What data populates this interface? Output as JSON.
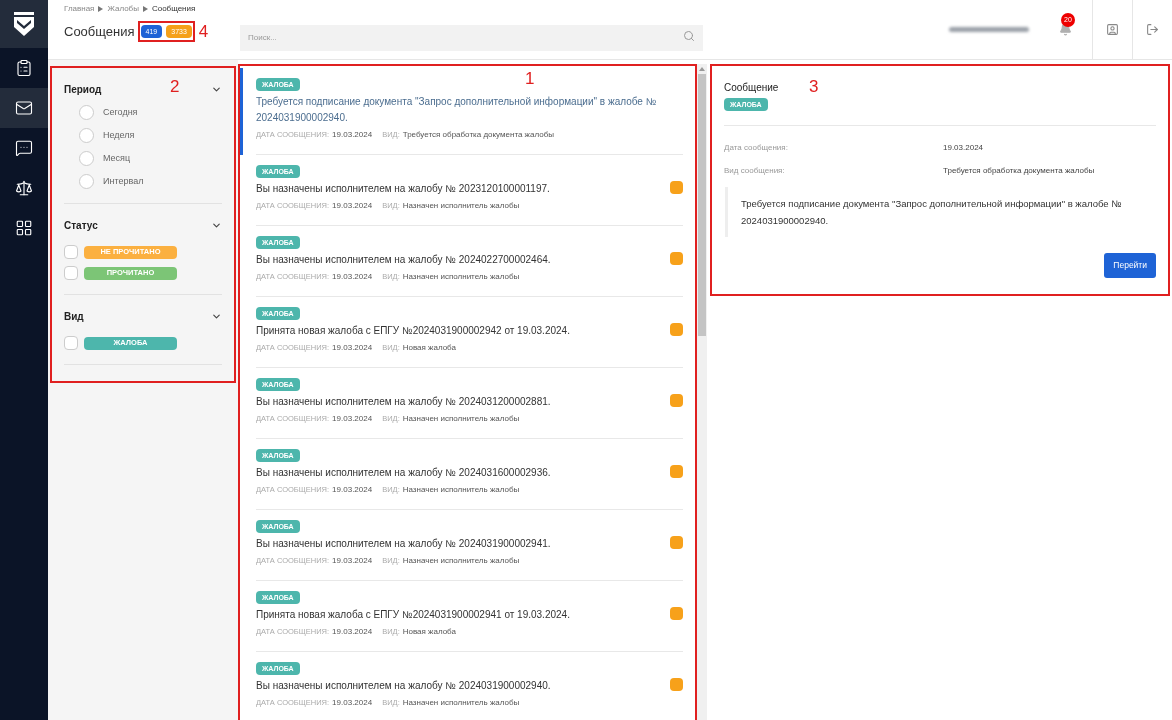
{
  "sidebar": {
    "items": [
      {
        "selected": false
      },
      {
        "selected": true
      },
      {
        "selected": false
      },
      {
        "selected": false
      },
      {
        "selected": false
      }
    ]
  },
  "header": {
    "breadcrumbs": [
      "Главная",
      "Жалобы",
      "Сообщения"
    ],
    "title": "Сообщения",
    "counters": [
      {
        "value": "419",
        "color": "#1e63d6"
      },
      {
        "value": "3733",
        "color": "#f5a01a"
      }
    ],
    "annotation": "4",
    "search": {
      "placeholder": "Поиск..."
    },
    "notifications": "20"
  },
  "filters": {
    "annotation": "2",
    "sections": [
      {
        "title": "Период",
        "expanded": true,
        "kind": "radio",
        "options": [
          {
            "label": "Сегодня",
            "selected": false
          },
          {
            "label": "Неделя",
            "selected": false
          },
          {
            "label": "Месяц",
            "selected": false
          },
          {
            "label": "Интервал",
            "selected": false
          }
        ]
      },
      {
        "title": "Статус",
        "expanded": true,
        "kind": "tag",
        "options": [
          {
            "label": "НЕ ПРОЧИТАНО",
            "checked": false,
            "color": "#fbb040"
          },
          {
            "label": "ПРОЧИТАНО",
            "checked": false,
            "color": "#7cc576"
          }
        ]
      },
      {
        "title": "Вид",
        "expanded": true,
        "kind": "tag",
        "options": [
          {
            "label": "ЖАЛОБА",
            "checked": false,
            "color": "#4db6ac"
          }
        ]
      }
    ]
  },
  "list": {
    "annotation": "1",
    "items": [
      {
        "tag": "ЖАЛОБА",
        "title": "Требуется подписание документа \"Запрос дополнительной информации\" в жалобе № 2024031900002940.",
        "date_label": "ДАТА СООБЩЕНИЯ:",
        "date": "19.03.2024",
        "kind_label": "ВИД:",
        "kind": "Требуется обработка документа жалобы",
        "selected": true,
        "unread": false
      },
      {
        "tag": "ЖАЛОБА",
        "title": "Вы назначены исполнителем на жалобу № 2023120100001197.",
        "date_label": "ДАТА СООБЩЕНИЯ:",
        "date": "19.03.2024",
        "kind_label": "ВИД:",
        "kind": "Назначен исполнитель жалобы",
        "selected": false,
        "unread": true
      },
      {
        "tag": "ЖАЛОБА",
        "title": "Вы назначены исполнителем на жалобу № 2024022700002464.",
        "date_label": "ДАТА СООБЩЕНИЯ:",
        "date": "19.03.2024",
        "kind_label": "ВИД:",
        "kind": "Назначен исполнитель жалобы",
        "selected": false,
        "unread": true
      },
      {
        "tag": "ЖАЛОБА",
        "title": "Принята новая жалоба с ЕПГУ №2024031900002942 от 19.03.2024.",
        "date_label": "ДАТА СООБЩЕНИЯ:",
        "date": "19.03.2024",
        "kind_label": "ВИД:",
        "kind": "Новая жалоба",
        "selected": false,
        "unread": true
      },
      {
        "tag": "ЖАЛОБА",
        "title": "Вы назначены исполнителем на жалобу № 2024031200002881.",
        "date_label": "ДАТА СООБЩЕНИЯ:",
        "date": "19.03.2024",
        "kind_label": "ВИД:",
        "kind": "Назначен исполнитель жалобы",
        "selected": false,
        "unread": true
      },
      {
        "tag": "ЖАЛОБА",
        "title": "Вы назначены исполнителем на жалобу № 2024031600002936.",
        "date_label": "ДАТА СООБЩЕНИЯ:",
        "date": "19.03.2024",
        "kind_label": "ВИД:",
        "kind": "Назначен исполнитель жалобы",
        "selected": false,
        "unread": true
      },
      {
        "tag": "ЖАЛОБА",
        "title": "Вы назначены исполнителем на жалобу № 2024031900002941.",
        "date_label": "ДАТА СООБЩЕНИЯ:",
        "date": "19.03.2024",
        "kind_label": "ВИД:",
        "kind": "Назначен исполнитель жалобы",
        "selected": false,
        "unread": true
      },
      {
        "tag": "ЖАЛОБА",
        "title": "Принята новая жалоба с ЕПГУ №2024031900002941 от 19.03.2024.",
        "date_label": "ДАТА СООБЩЕНИЯ:",
        "date": "19.03.2024",
        "kind_label": "ВИД:",
        "kind": "Новая жалоба",
        "selected": false,
        "unread": true
      },
      {
        "tag": "ЖАЛОБА",
        "title": "Вы назначены исполнителем на жалобу № 2024031900002940.",
        "date_label": "ДАТА СООБЩЕНИЯ:",
        "date": "19.03.2024",
        "kind_label": "ВИД:",
        "kind": "Назначен исполнитель жалобы",
        "selected": false,
        "unread": true
      }
    ]
  },
  "detail": {
    "annotation": "3",
    "title": "Сообщение",
    "tag": "ЖАЛОБА",
    "fields": [
      {
        "label": "Дата сообщения:",
        "value": "19.03.2024"
      },
      {
        "label": "Вид сообщения:",
        "value": "Требуется обработка документа жалобы"
      }
    ],
    "text": "Требуется подписание документа \"Запрос дополнительной информации\" в жалобе № 2024031900002940.",
    "button": "Перейти"
  }
}
